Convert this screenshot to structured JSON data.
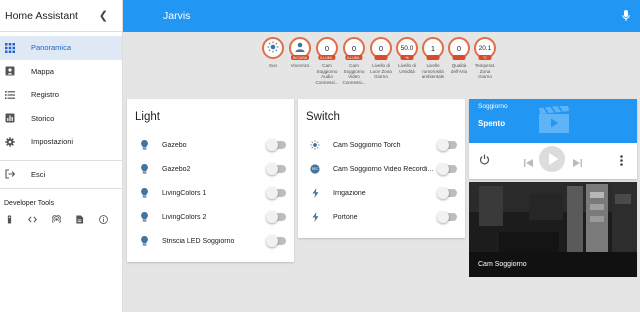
{
  "sidebar": {
    "title": "Home Assistant",
    "items": [
      {
        "label": "Panoramica",
        "icon": "grid-icon",
        "active": true
      },
      {
        "label": "Mappa",
        "icon": "map-icon"
      },
      {
        "label": "Registro",
        "icon": "list-icon"
      },
      {
        "label": "Storico",
        "icon": "chart-icon"
      },
      {
        "label": "Impostazioni",
        "icon": "gear-icon"
      }
    ],
    "logout": "Esci",
    "dev_title": "Developer Tools",
    "dev_tools": [
      "remote-icon",
      "code-icon",
      "signal-icon",
      "template-icon",
      "info-icon"
    ]
  },
  "topbar": {
    "title": "Jarvis",
    "mic_icon": "microphone-icon"
  },
  "badges": [
    {
      "value": "",
      "icon": "sun-icon",
      "tag": "",
      "label": "Sun"
    },
    {
      "value": "",
      "icon": "person-icon",
      "tag": "IN CASA",
      "label": "Vincenzo"
    },
    {
      "value": "0",
      "tag": "ILLUMI..",
      "label": "Cam Soggiorno Audio Connessi..."
    },
    {
      "value": "0",
      "tag": "ILLUMI..",
      "label": "Cam Soggiorno Video Connessi..."
    },
    {
      "value": "0",
      "tag": "",
      "label": "Livello di Luce Zona Giorno"
    },
    {
      "value": "50.0",
      "tag": "%",
      "label": "Livello di Umidità"
    },
    {
      "value": "1",
      "tag": "",
      "label": "Livello rumorosità ambientale"
    },
    {
      "value": "0",
      "tag": "",
      "label": "Qualità dell'Aria"
    },
    {
      "value": "20.1",
      "tag": "°C",
      "label": "Temperat. Zona Giorno"
    }
  ],
  "light_card": {
    "title": "Light",
    "rows": [
      {
        "label": "Gazebo",
        "icon": "bulb-icon"
      },
      {
        "label": "Gazebo2",
        "icon": "bulb-icon"
      },
      {
        "label": "LivingColors 1",
        "icon": "bulb-icon"
      },
      {
        "label": "LivingColors 2",
        "icon": "bulb-icon"
      },
      {
        "label": "Striscia LED Soggiorno",
        "icon": "bulb-icon"
      }
    ]
  },
  "switch_card": {
    "title": "Switch",
    "rows": [
      {
        "label": "Cam Soggiorno Torch",
        "icon": "sun-icon"
      },
      {
        "label": "Cam Soggiorno Video Recordi...",
        "icon": "video-icon"
      },
      {
        "label": "Irrigazione",
        "icon": "flash-icon"
      },
      {
        "label": "Portone",
        "icon": "flash-icon"
      }
    ]
  },
  "media_player": {
    "source": "Soggiorno",
    "state": "Spento"
  },
  "camera": {
    "label": "Cam Soggiorno"
  },
  "colors": {
    "accent": "#2196f3",
    "badge_border": "#e06e49",
    "icon": "#44739e",
    "active_nav_bg": "#dfe9f6",
    "active_nav_text": "#1e63c9"
  }
}
